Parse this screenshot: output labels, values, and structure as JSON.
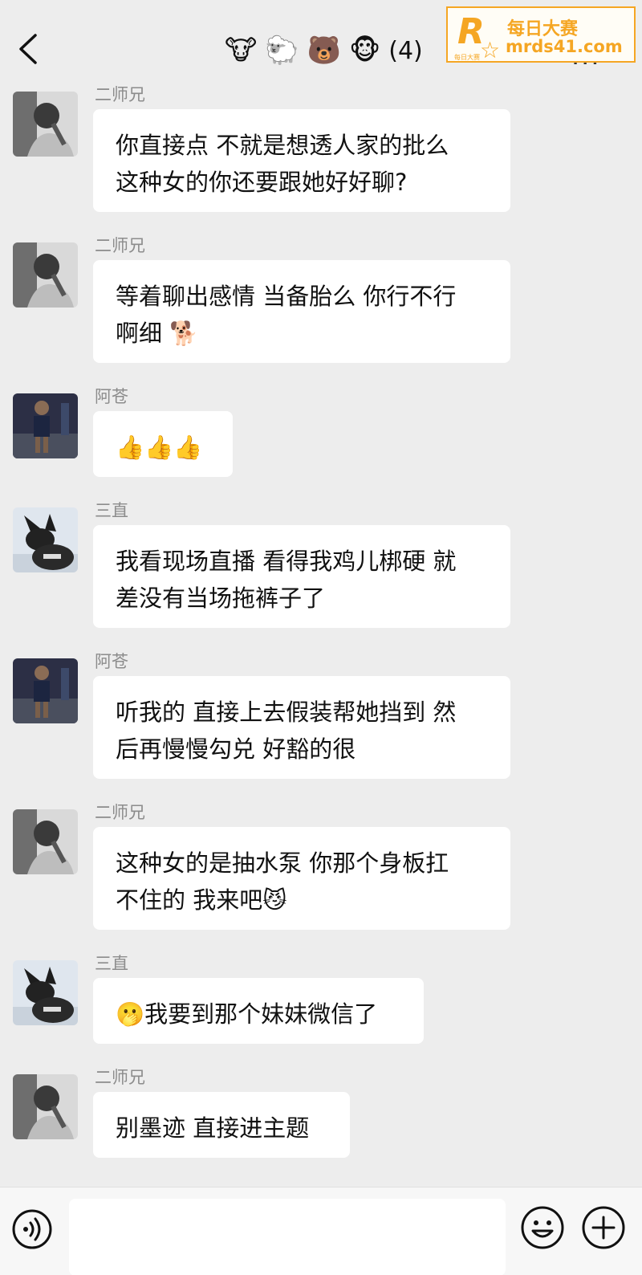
{
  "header": {
    "back_icon": "chevron-left-icon",
    "title_emojis": [
      "🐮",
      "🐑",
      "🐻",
      "🐵"
    ],
    "member_count": "(4)",
    "more_label": "..."
  },
  "watermark": {
    "logo_letter": "R",
    "logo_small": "每日大赛",
    "line1": "每日大赛",
    "line2": "mrds41.com",
    "color": "#f5a623"
  },
  "messages": [
    {
      "sender": "二师兄",
      "avatar": "avatar-erShiXiong",
      "text": "你直接点 不就是想透人家的批么\n这种女的你还要跟她好好聊?"
    },
    {
      "sender": "二师兄",
      "avatar": "avatar-erShiXiong",
      "text": "等着聊出感情 当备胎么 你行不行\n啊细 🐕"
    },
    {
      "sender": "阿苍",
      "avatar": "avatar-aCang",
      "text": "👍👍👍"
    },
    {
      "sender": "三直",
      "avatar": "avatar-sanZhi",
      "text": "我看现场直播 看得我鸡儿梆硬 就\n差没有当场拖裤子了"
    },
    {
      "sender": "阿苍",
      "avatar": "avatar-aCang",
      "text": "听我的 直接上去假装帮她挡到 然\n后再慢慢勾兑 好豁的很"
    },
    {
      "sender": "二师兄",
      "avatar": "avatar-erShiXiong",
      "text": "这种女的是抽水泵 你那个身板扛\n不住的 我来吧😼"
    },
    {
      "sender": "三直",
      "avatar": "avatar-sanZhi",
      "text": "🫢我要到那个妹妹微信了"
    },
    {
      "sender": "二师兄",
      "avatar": "avatar-erShiXiong",
      "text": "别墨迹 直接进主题"
    }
  ],
  "input_bar": {
    "voice_icon": "voice-icon",
    "input_value": "",
    "emoji_icon": "smiley-icon",
    "plus_icon": "plus-icon"
  }
}
